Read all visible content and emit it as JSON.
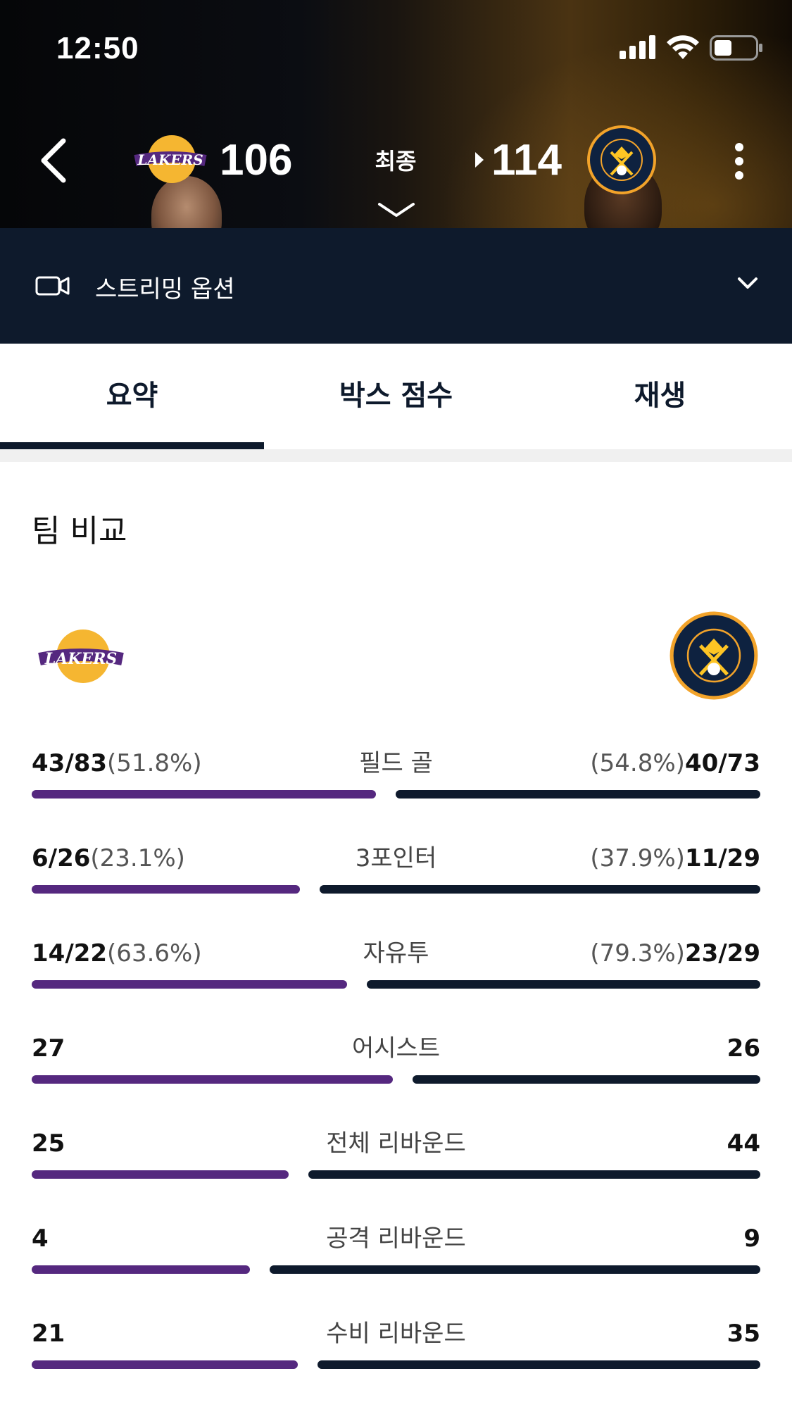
{
  "status_bar": {
    "time": "12:50"
  },
  "header": {
    "away_team": {
      "name": "LAKERS",
      "score": "106"
    },
    "home_team": {
      "name": "DENVER NUGGETS",
      "score": "114"
    },
    "game_status": "최종"
  },
  "streaming": {
    "label": "스트리밍 옵션"
  },
  "tabs": [
    {
      "label": "요약",
      "active": true
    },
    {
      "label": "박스 점수",
      "active": false
    },
    {
      "label": "재생",
      "active": false
    }
  ],
  "comparison": {
    "title": "팀 비교",
    "colors": {
      "left": "#55287f",
      "right": "#0e1a2c"
    },
    "stats": [
      {
        "name": "필드 골",
        "left_main": "43/83",
        "left_pct": "(51.8%)",
        "right_main": "40/73",
        "right_pct": "(54.8%)",
        "left_value": 0.518,
        "right_value": 0.548
      },
      {
        "name": "3포인터",
        "left_main": "6/26",
        "left_pct": "(23.1%)",
        "right_main": "11/29",
        "right_pct": "(37.9%)",
        "left_value": 0.231,
        "right_value": 0.379
      },
      {
        "name": "자유투",
        "left_main": "14/22",
        "left_pct": "(63.6%)",
        "right_main": "23/29",
        "right_pct": "(79.3%)",
        "left_value": 0.636,
        "right_value": 0.793
      },
      {
        "name": "어시스트",
        "left_main": "27",
        "left_pct": "",
        "right_main": "26",
        "right_pct": "",
        "left_value": 27,
        "right_value": 26
      },
      {
        "name": "전체 리바운드",
        "left_main": "25",
        "left_pct": "",
        "right_main": "44",
        "right_pct": "",
        "left_value": 25,
        "right_value": 44
      },
      {
        "name": "공격 리바운드",
        "left_main": "4",
        "left_pct": "",
        "right_main": "9",
        "right_pct": "",
        "left_value": 4,
        "right_value": 9
      },
      {
        "name": "수비 리바운드",
        "left_main": "21",
        "left_pct": "",
        "right_main": "35",
        "right_pct": "",
        "left_value": 21,
        "right_value": 35
      }
    ]
  }
}
